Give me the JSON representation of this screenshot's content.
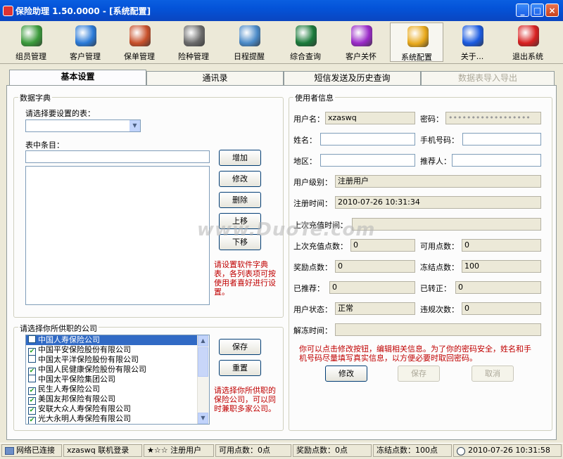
{
  "window": {
    "title": "保险助理 1.50.0000 - [系统配置]",
    "min": "_",
    "max": "□",
    "close": "×"
  },
  "toolbar": [
    {
      "label": "组员管理",
      "color": "#3a9a3a"
    },
    {
      "label": "客户管理",
      "color": "#2a7ad8"
    },
    {
      "label": "保单管理",
      "color": "#c8502a"
    },
    {
      "label": "险种管理",
      "color": "#6a6a6a"
    },
    {
      "label": "日程提醒",
      "color": "#4a8ac8"
    },
    {
      "label": "综合查询",
      "color": "#1a7a3a"
    },
    {
      "label": "客户关怀",
      "color": "#9a2ac8"
    },
    {
      "label": "系统配置",
      "color": "#e8a81a"
    },
    {
      "label": "关于...",
      "color": "#1a5ae0"
    },
    {
      "label": "退出系统",
      "color": "#d82020"
    }
  ],
  "tabs": [
    "基本设置",
    "通讯录",
    "短信发送及历史查询",
    "数据表导入导出"
  ],
  "dict": {
    "legend": "数据字典",
    "table_label": "请选择要设置的表：",
    "table_value": "",
    "items_label": "表中条目：",
    "item_value": "",
    "buttons": [
      "增加",
      "修改",
      "删除",
      "上移",
      "下移"
    ],
    "hint": "请设置软件字典表，各列表项可按使用者喜好进行设置。"
  },
  "company": {
    "legend": "请选择你所供职的公司",
    "items": [
      {
        "name": "中国人寿保险公司",
        "checked": false,
        "selected": true
      },
      {
        "name": "中国平安保险股份有限公司",
        "checked": true
      },
      {
        "name": "中国太平洋保险股份有限公司",
        "checked": false
      },
      {
        "name": "中国人民健康保险股份有限公司",
        "checked": true
      },
      {
        "name": "中国太平保险集团公司",
        "checked": false
      },
      {
        "name": "民生人寿保险公司",
        "checked": true
      },
      {
        "name": "美国友邦保险有限公司",
        "checked": true
      },
      {
        "name": "安联大众人寿保险有限公司",
        "checked": true
      },
      {
        "name": "光大永明人寿保险有限公司",
        "checked": true
      }
    ],
    "save": "保存",
    "reset": "重置",
    "hint": "请选择你所供职的保险公司，可以同时兼职多家公司。"
  },
  "user": {
    "legend": "使用者信息",
    "username_label": "用户名：",
    "username": "xzaswq",
    "password_label": "密码：",
    "password": "••••••••••••••••••",
    "name_label": "姓名：",
    "name": "",
    "mobile_label": "手机号码：",
    "mobile": "",
    "region_label": "地区：",
    "region": "",
    "referrer_label": "推荐人：",
    "referrer": "",
    "level_label": "用户级别：",
    "level": "注册用户",
    "regtime_label": "注册时间：",
    "regtime": "2010-07-26 10:31:34",
    "lastcharge_label": "上次充值时间：",
    "lastcharge": "",
    "lastpoints_label": "上次充值点数：",
    "lastpoints": "0",
    "avail_label": "可用点数：",
    "avail": "0",
    "reward_label": "奖励点数：",
    "reward": "0",
    "frozen_label": "冻结点数：",
    "frozen": "100",
    "recommended_label": "已推荐：",
    "recommended": "0",
    "converted_label": "已转正：",
    "converted": "0",
    "status_label": "用户状态：",
    "status": "正常",
    "violations_label": "违规次数：",
    "violations": "0",
    "unfreeze_label": "解冻时间：",
    "unfreeze": "",
    "hint": "你可以点击修改按钮，编辑相关信息。为了你的密码安全，姓名和手机号码尽量填写真实信息，以方便必要时取回密码。",
    "edit": "修改",
    "save": "保存",
    "cancel": "取消"
  },
  "status": {
    "network": "网络已连接",
    "login": "xzaswq 联机登录",
    "rank": "★☆☆ 注册用户",
    "avail": "可用点数：0点",
    "reward": "奖励点数：0点",
    "frozen": "冻结点数：100点",
    "time": "2010-07-26 10:31:58"
  },
  "watermark": "www.DuoTe.com"
}
